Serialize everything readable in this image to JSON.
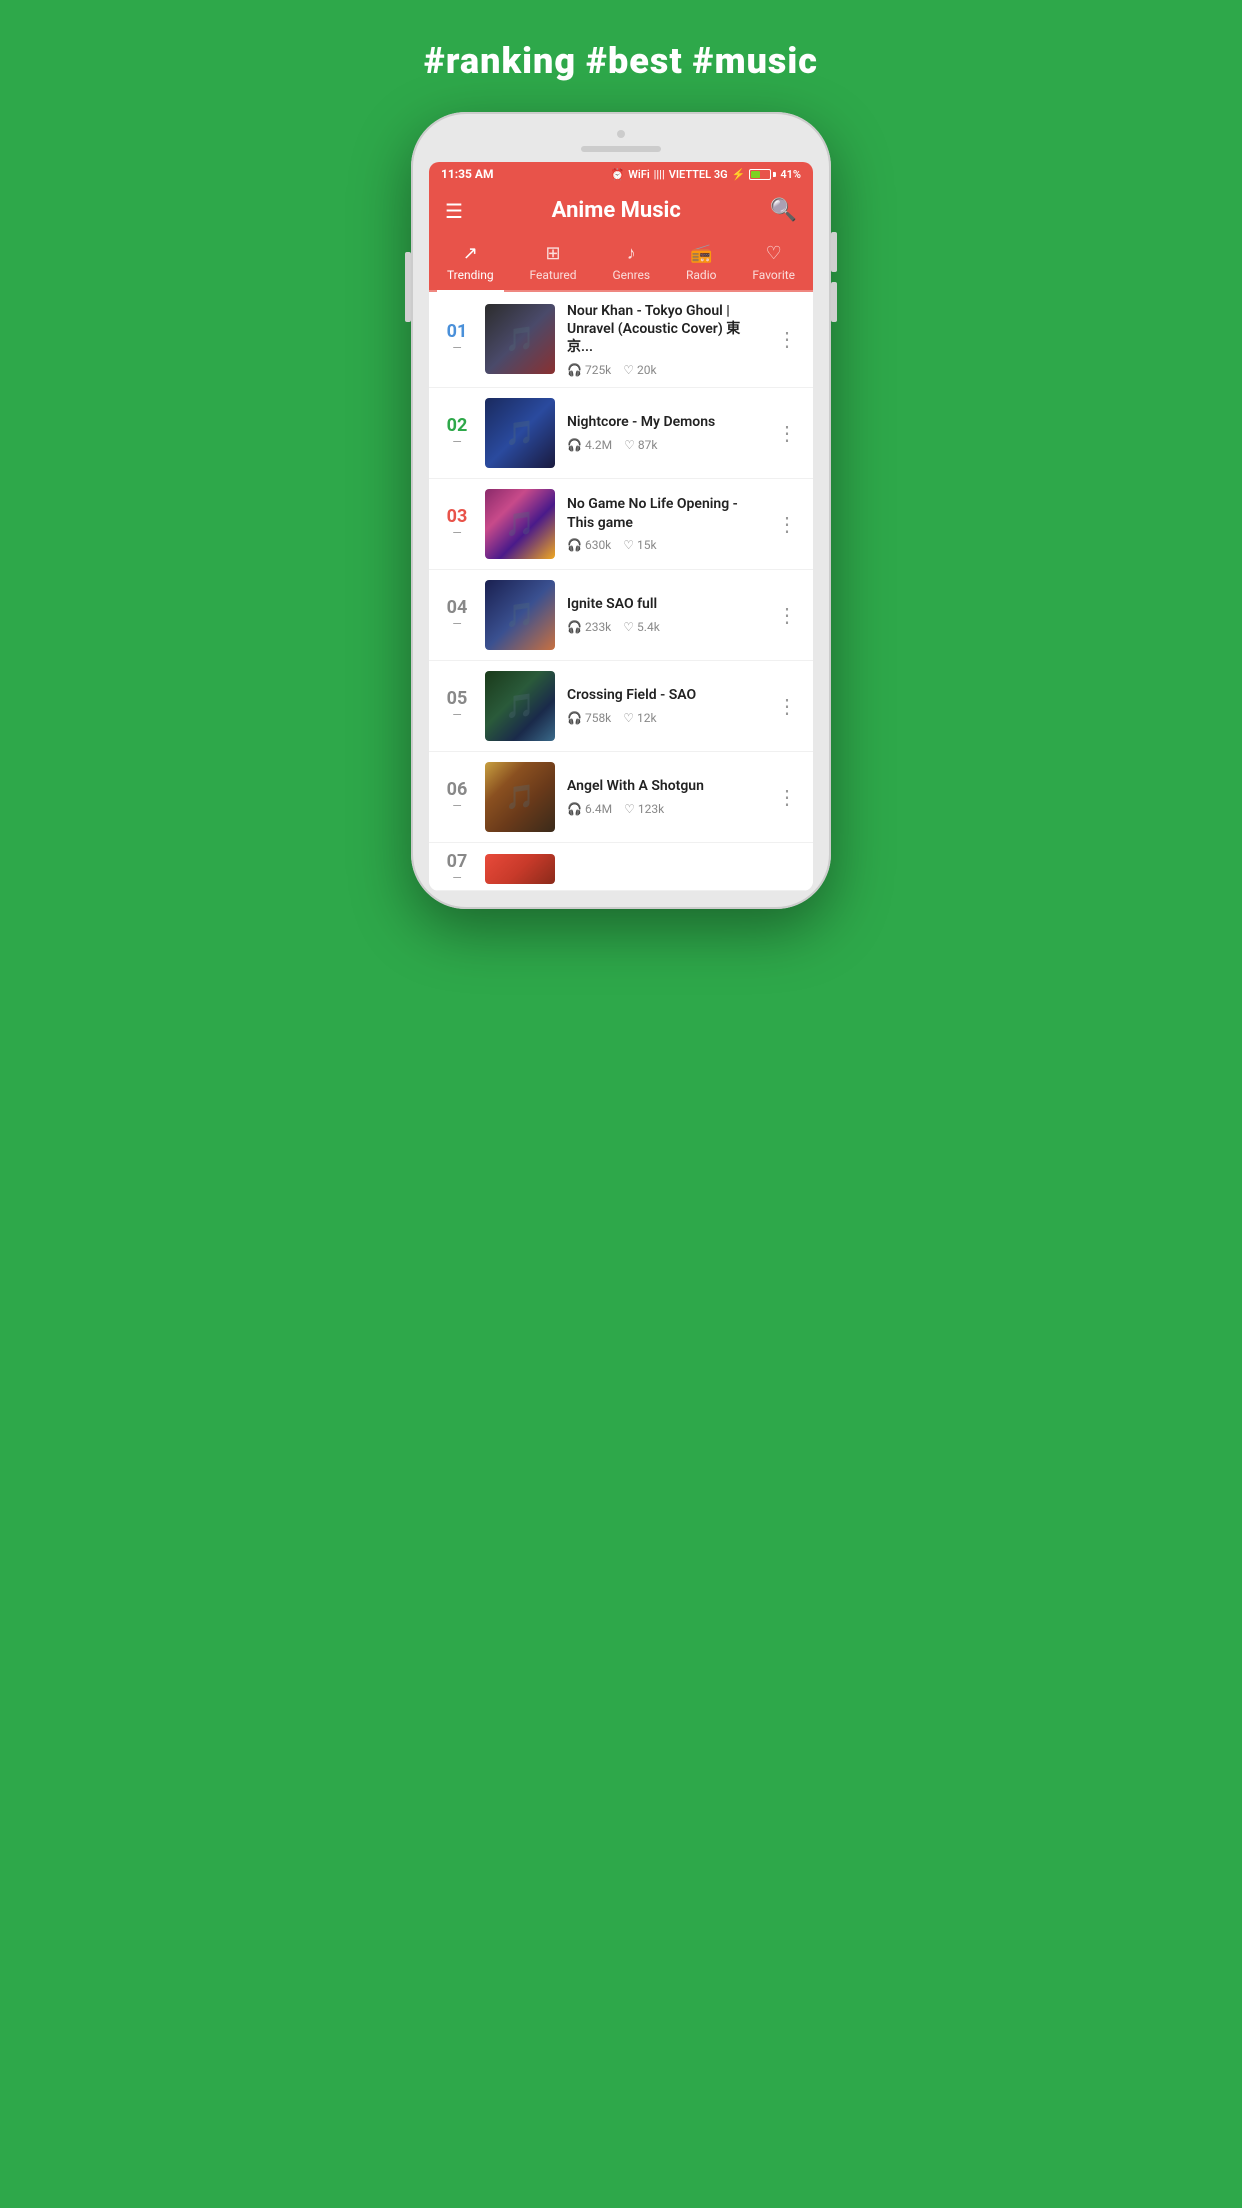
{
  "page": {
    "headline": "#ranking #best #music",
    "background_color": "#2ea84a"
  },
  "status_bar": {
    "time": "11:35 AM",
    "carrier": "VIETTEL 3G",
    "battery": "41%",
    "signal_icon": "signal-icon",
    "wifi_icon": "wifi-icon",
    "alarm_icon": "alarm-icon",
    "bolt_icon": "bolt-icon"
  },
  "app_header": {
    "title": "Anime Music",
    "menu_icon": "menu-icon",
    "search_icon": "search-icon"
  },
  "tabs": [
    {
      "id": "trending",
      "label": "Trending",
      "icon": "trending-icon",
      "active": true
    },
    {
      "id": "featured",
      "label": "Featured",
      "icon": "featured-icon",
      "active": false
    },
    {
      "id": "genres",
      "label": "Genres",
      "icon": "genres-icon",
      "active": false
    },
    {
      "id": "radio",
      "label": "Radio",
      "icon": "radio-icon",
      "active": false
    },
    {
      "id": "favorite",
      "label": "Favorite",
      "icon": "favorite-icon",
      "active": false
    }
  ],
  "songs": [
    {
      "rank": "01",
      "rank_class": "rank-1",
      "title": "Nour Khan - Tokyo Ghoul | Unravel (Acoustic Cover) 東京...",
      "plays": "725k",
      "likes": "20k",
      "thumb_class": "thumb-1"
    },
    {
      "rank": "02",
      "rank_class": "rank-2",
      "title": "Nightcore - My Demons",
      "plays": "4.2M",
      "likes": "87k",
      "thumb_class": "thumb-2"
    },
    {
      "rank": "03",
      "rank_class": "rank-3",
      "title": "No Game No Life Opening - This game",
      "plays": "630k",
      "likes": "15k",
      "thumb_class": "thumb-3"
    },
    {
      "rank": "04",
      "rank_class": "rank-other",
      "title": "Ignite SAO full",
      "plays": "233k",
      "likes": "5.4k",
      "thumb_class": "thumb-4"
    },
    {
      "rank": "05",
      "rank_class": "rank-other",
      "title": "Crossing Field - SAO",
      "plays": "758k",
      "likes": "12k",
      "thumb_class": "thumb-5"
    },
    {
      "rank": "06",
      "rank_class": "rank-other",
      "title": "Angel With A Shotgun",
      "plays": "6.4M",
      "likes": "123k",
      "thumb_class": "thumb-6"
    }
  ],
  "icons": {
    "headphone": "🎧",
    "heart": "♡",
    "more": "⋮",
    "trending": "↗",
    "featured": "⊞",
    "genres": "♪",
    "radio": "📻",
    "favorite": "♡",
    "menu": "☰",
    "search": "🔍"
  }
}
